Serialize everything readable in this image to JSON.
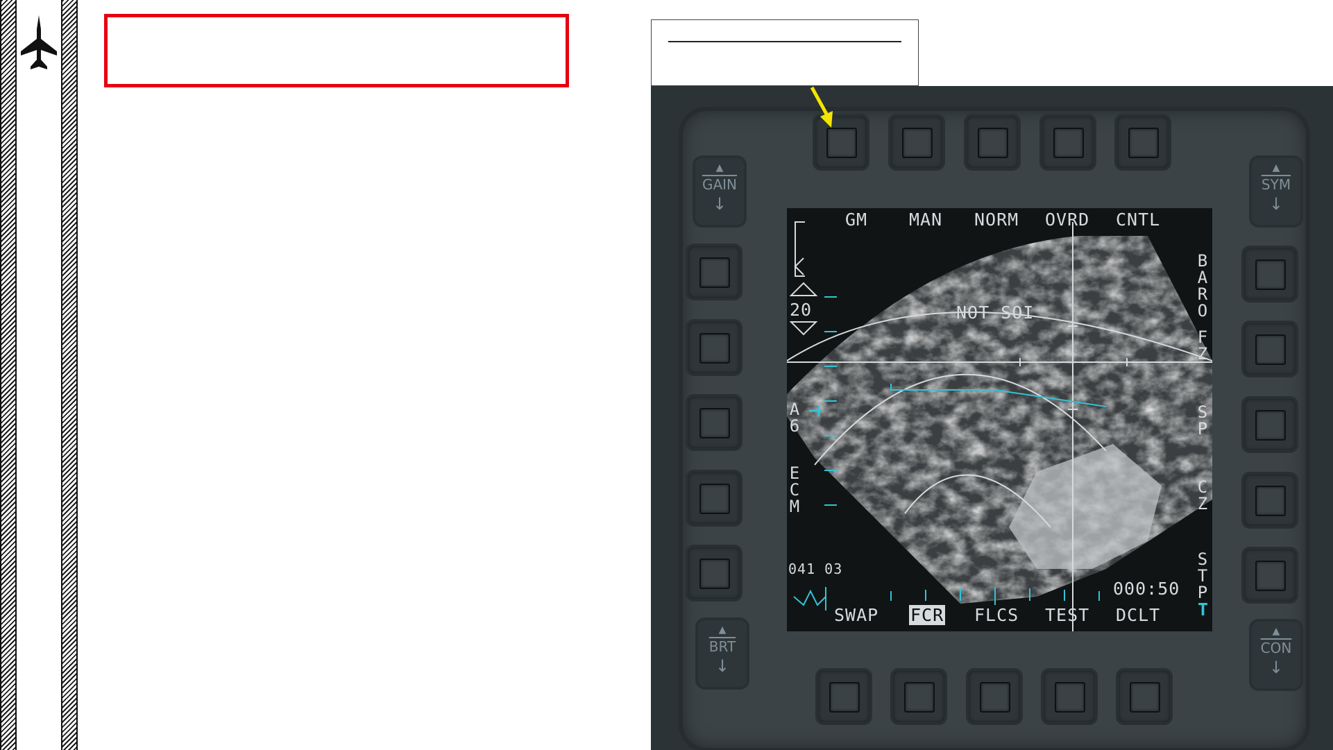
{
  "mfd": {
    "top_labels": [
      "GM",
      "MAN",
      "NORM",
      "OVRD",
      "CNTL"
    ],
    "bottom_labels": [
      "SWAP",
      "FCR",
      "FLCS",
      "TEST",
      "DCLT"
    ],
    "right_labels": [
      "BARO",
      "FZ",
      "SP",
      "CZ",
      "STP"
    ],
    "left_labels": [
      "A6",
      "ECM"
    ],
    "range_value": "20",
    "not_soi": "NOT SOI",
    "coords": "041 03",
    "timer": "000:50",
    "t_marker": "T",
    "rockers": {
      "gain": "GAIN",
      "sym": "SYM",
      "brt": "BRT",
      "con": "CON"
    }
  },
  "colors": {
    "title_box_border": "#e60012",
    "callout_arrow": "#f2e600",
    "symbology": "#d7dbde",
    "cyan": "#33c4d6"
  }
}
